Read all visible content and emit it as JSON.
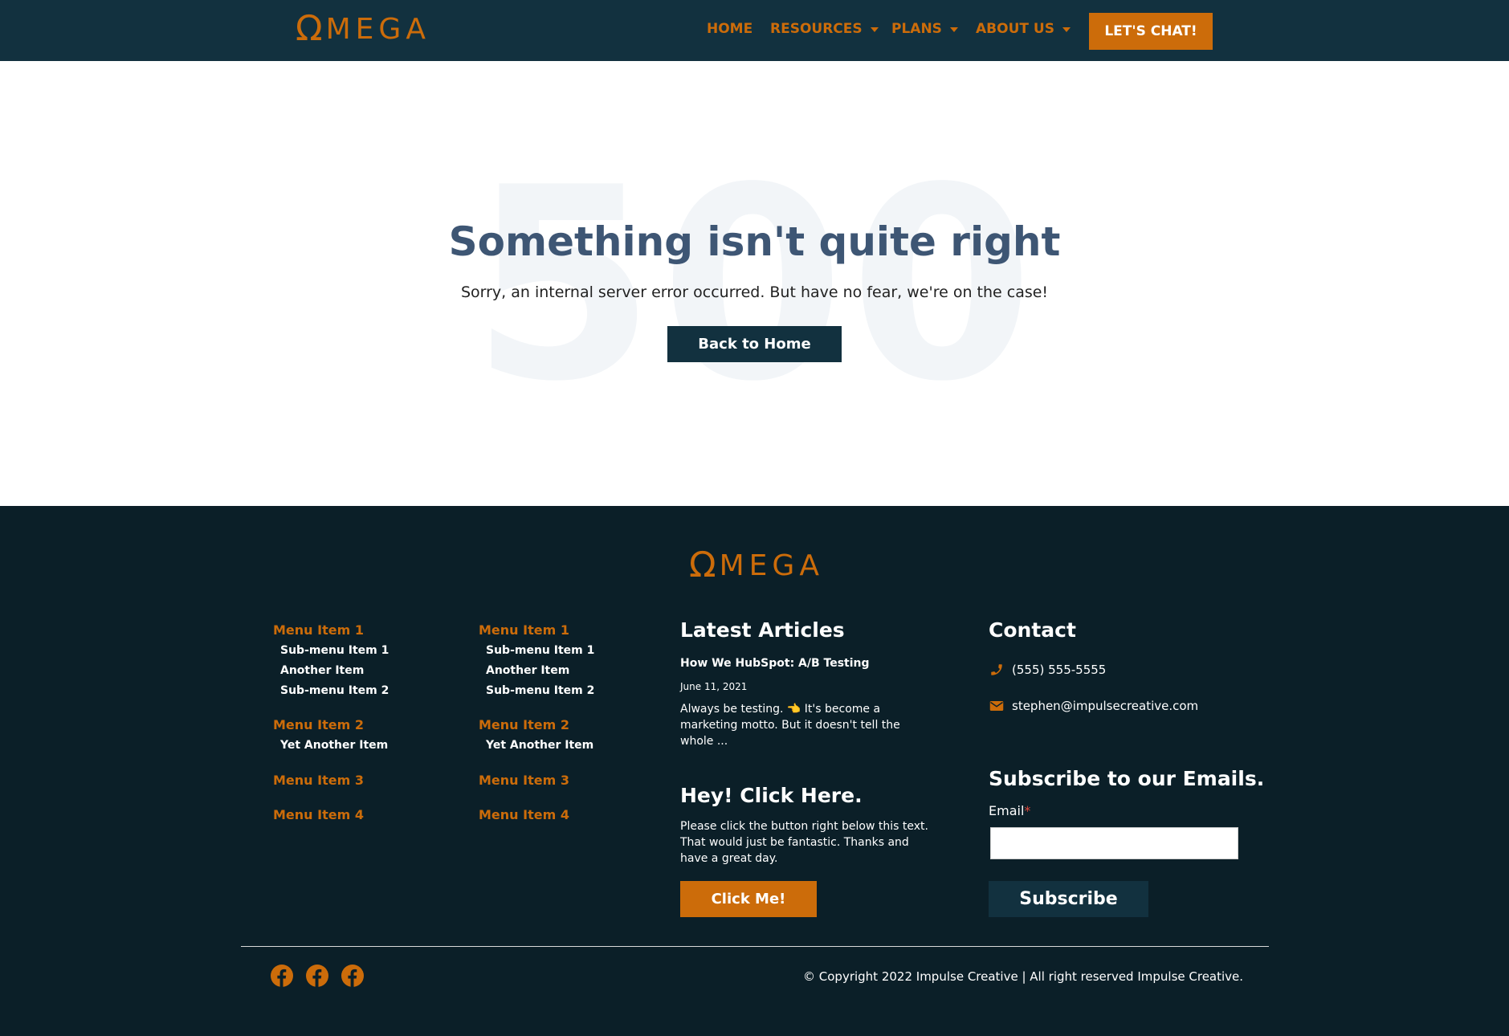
{
  "colors": {
    "accent": "#cc6c0a",
    "header_bg": "#12313f",
    "footer_bg": "#0b1f28",
    "title": "#3e5674"
  },
  "brand": {
    "omega": "Ω",
    "name": "MEGA"
  },
  "nav": {
    "items": [
      {
        "label": "HOME",
        "has_dropdown": false
      },
      {
        "label": "RESOURCES",
        "has_dropdown": true
      },
      {
        "label": "PLANS",
        "has_dropdown": true
      },
      {
        "label": "ABOUT US",
        "has_dropdown": true
      }
    ],
    "cta": "LET'S CHAT!"
  },
  "error": {
    "code": "500",
    "title": "Something isn't quite right",
    "message": "Sorry, an internal server error occurred. But have no fear, we're on the case!",
    "button": "Back to Home"
  },
  "footer": {
    "menus": [
      {
        "items": [
          {
            "label": "Menu Item 1",
            "subs": [
              "Sub-menu Item 1",
              "Another Item",
              "Sub-menu Item 2"
            ]
          },
          {
            "label": "Menu Item 2",
            "subs": [
              "Yet Another Item"
            ]
          },
          {
            "label": "Menu Item 3",
            "subs": []
          },
          {
            "label": "Menu Item 4",
            "subs": []
          }
        ]
      },
      {
        "items": [
          {
            "label": "Menu Item 1",
            "subs": [
              "Sub-menu Item 1",
              "Another Item",
              "Sub-menu Item 2"
            ]
          },
          {
            "label": "Menu Item 2",
            "subs": [
              "Yet Another Item"
            ]
          },
          {
            "label": "Menu Item 3",
            "subs": []
          },
          {
            "label": "Menu Item 4",
            "subs": []
          }
        ]
      }
    ],
    "articles": {
      "heading": "Latest Articles",
      "title": "How We HubSpot: A/B Testing",
      "date": "June 11, 2021",
      "excerpt": "Always be testing. 👈 It's become a marketing motto. But it doesn't tell the whole ..."
    },
    "promo": {
      "heading": "Hey! Click Here.",
      "text": "Please click the button right below this text. That would just be fantastic. Thanks and have a great day.",
      "button": "Click Me!"
    },
    "contact": {
      "heading": "Contact",
      "phone": "(555) 555-5555",
      "email": "stephen@impulsecreative.com"
    },
    "subscribe": {
      "heading": "Subscribe to our Emails.",
      "email_label": "Email",
      "required_mark": "*",
      "email_value": "",
      "button": "Subscribe"
    },
    "social_icons": [
      "facebook-icon",
      "facebook-icon",
      "facebook-icon"
    ],
    "copyright": "© Copyright 2022 Impulse Creative | All right reserved Impulse Creative."
  }
}
